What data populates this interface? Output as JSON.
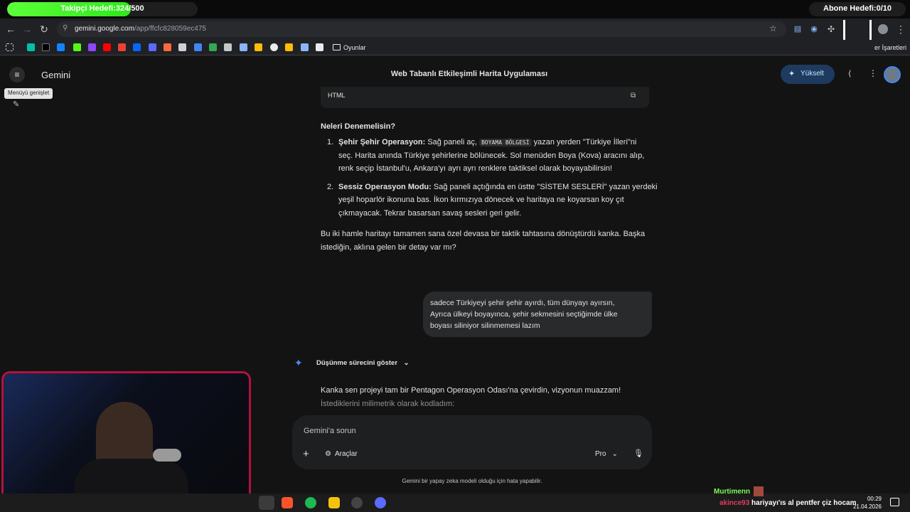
{
  "overlay": {
    "follower_goal": "Takipçi Hedefi:324/500",
    "follower_progress": 0.648,
    "subscriber_goal": "Abone Hedefi:0/10"
  },
  "browser": {
    "url_host": "gemini.google.com",
    "url_path": "/app/ffcfc828059ec475",
    "bookmark_folder": "Oyunlar",
    "bookmarks_right": "Tüm Yer İşaretleri",
    "bookmarks_right_visible": "er İşaretleri"
  },
  "app": {
    "name": "Gemini",
    "chat_title": "Web Tabanlı Etkileşimli Harita Uygulaması",
    "upgrade_label": "Yükselt",
    "tooltip": "Menüyü genişlet"
  },
  "response": {
    "code_lang": "HTML",
    "heading": "Neleri Denemelisin?",
    "items": [
      {
        "num": "1.",
        "title": "Şehir Şehir Operasyon:",
        "text_a": " Sağ paneli aç, ",
        "chip": "BOYAMA BÖLGESİ",
        "text_b": " yazan yerden \"Türkiye İlleri\"ni",
        "line2": "seç. Harita anında Türkiye şehirlerine bölünecek. Sol menüden Boya (Kova) aracını alıp,",
        "line3": "renk seçip İstanbul'u, Ankara'yı ayrı ayrı renklere taktiksel olarak boyayabilirsin!"
      },
      {
        "num": "2.",
        "title": "Sessiz Operasyon Modu:",
        "line1": " Sağ paneli açtığında en üstte \"SİSTEM SESLERİ\" yazan yerdeki",
        "line2": "yeşil hoparlör ikonuna bas. İkon kırmızıya dönecek ve haritaya ne koyarsan koy çıt",
        "line3": "çıkmayacak. Tekrar basarsan savaş sesleri geri gelir."
      }
    ],
    "closing_line1": "Bu iki hamle haritayı tamamen sana özel devasa bir taktik tahtasına dönüştürdü kanka. Başka",
    "closing_line2": "istediğin, aklına gelen bir detay var mı?"
  },
  "user_message": {
    "line1": "sadece Türkiyeyi şehir şehir ayırdı, tüm dünyayı ayırsın,",
    "line2": "Ayrıca ülkeyi boyayınca, şehir sekmesini seçtiğimde ülke",
    "line3": "boyası siliniyor silinmemesi lazım"
  },
  "thinking_label": "Düşünme sürecini göster",
  "next_response": {
    "line1": "Kanka sen projeyi tam bir Pentagon Operasyon Odası'na çevirdin, vizyonun muazzam!",
    "line2": "İstediklerini milimetrik olarak kodladım:"
  },
  "composer": {
    "placeholder": "Gemini'a sorun",
    "tools_label": "Araçlar",
    "model_label": "Pro"
  },
  "disclaimer": "Gemini bir yapay zeka modeli olduğu için hata yapabilir.",
  "stream_chat": {
    "user1": "Murtimenn",
    "user2": "akince93",
    "message2": "hariyayı'ıs al pentfer çiz hocam"
  },
  "clock": {
    "time": "00:29",
    "date": "21.04.2026"
  },
  "colors": {
    "accent": "#1f3a5f",
    "bg": "#131314",
    "bubble": "#282a2c",
    "webcam_border": "#b3123a",
    "follow_fill": "#3cf020"
  }
}
